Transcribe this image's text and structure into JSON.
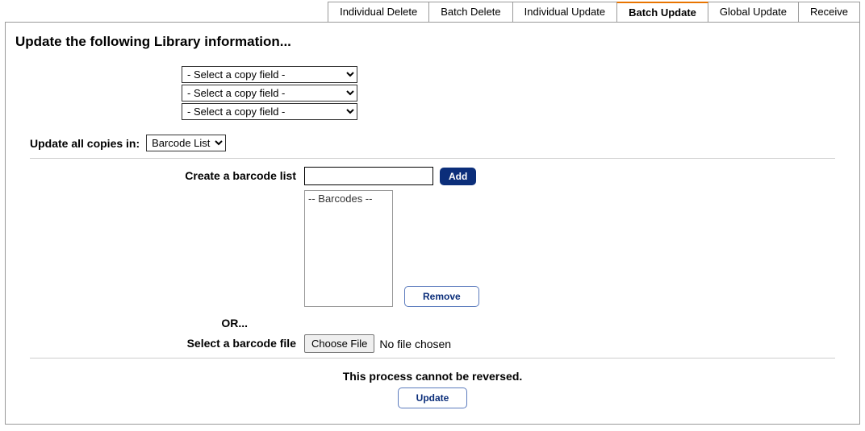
{
  "tabs": [
    {
      "label": "Individual Delete"
    },
    {
      "label": "Batch Delete"
    },
    {
      "label": "Individual Update"
    },
    {
      "label": "Batch Update",
      "active": true
    },
    {
      "label": "Global Update"
    },
    {
      "label": "Receive"
    }
  ],
  "heading": "Update the following Library information...",
  "copy_field_placeholder": "- Select a copy field -",
  "update_in_label": "Update all copies in:",
  "update_in_value": "Barcode List",
  "create_list_label": "Create a barcode list",
  "add_label": "Add",
  "barcodes_placeholder": "-- Barcodes --",
  "remove_label": "Remove",
  "or_label": "OR...",
  "select_file_label": "Select a barcode file",
  "choose_file_label": "Choose File",
  "no_file_label": "No file chosen",
  "warning_label": "This process cannot be reversed.",
  "update_btn_label": "Update"
}
